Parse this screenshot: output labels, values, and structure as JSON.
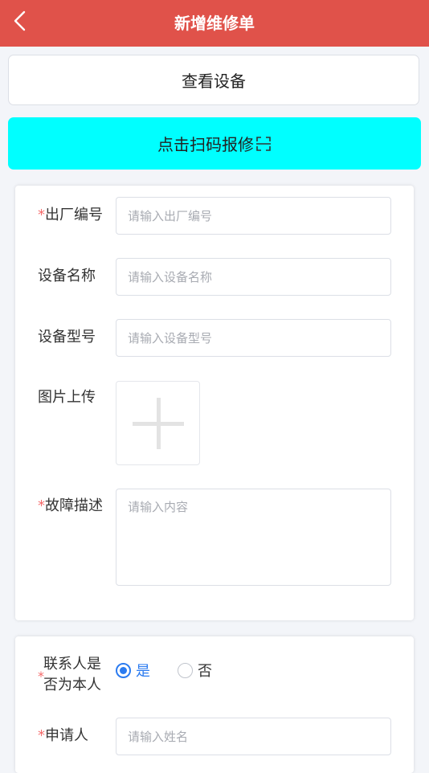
{
  "header": {
    "title": "新增维修单"
  },
  "actions": {
    "view_device": "查看设备",
    "scan_repair": "点击扫码报修"
  },
  "form": {
    "serial_number": {
      "required_mark": "*",
      "label": "出厂编号",
      "placeholder": "请输入出厂编号",
      "value": ""
    },
    "device_name": {
      "label": "设备名称",
      "placeholder": "请输入设备名称",
      "value": ""
    },
    "device_model": {
      "label": "设备型号",
      "placeholder": "请输入设备型号",
      "value": ""
    },
    "image_upload": {
      "label": "图片上传"
    },
    "fault_description": {
      "required_mark": "*",
      "label": "故障描述",
      "placeholder": "请输入内容",
      "value": ""
    }
  },
  "contact": {
    "is_self": {
      "required_mark": "*",
      "label_line1": "联系人是",
      "label_line2": "否为本人",
      "options": [
        {
          "label": "是",
          "selected": true
        },
        {
          "label": "否",
          "selected": false
        }
      ]
    },
    "applicant": {
      "required_mark": "*",
      "label": "申请人",
      "placeholder": "请输入姓名",
      "value": ""
    }
  },
  "colors": {
    "header_bg": "#e0524a",
    "scan_button_bg": "#00ffff",
    "required": "#f56c6c",
    "radio_active": "#2b7bf0"
  },
  "icons": {
    "back": "chevron-left-icon",
    "scan": "scan-frame-icon",
    "upload": "plus-icon"
  }
}
